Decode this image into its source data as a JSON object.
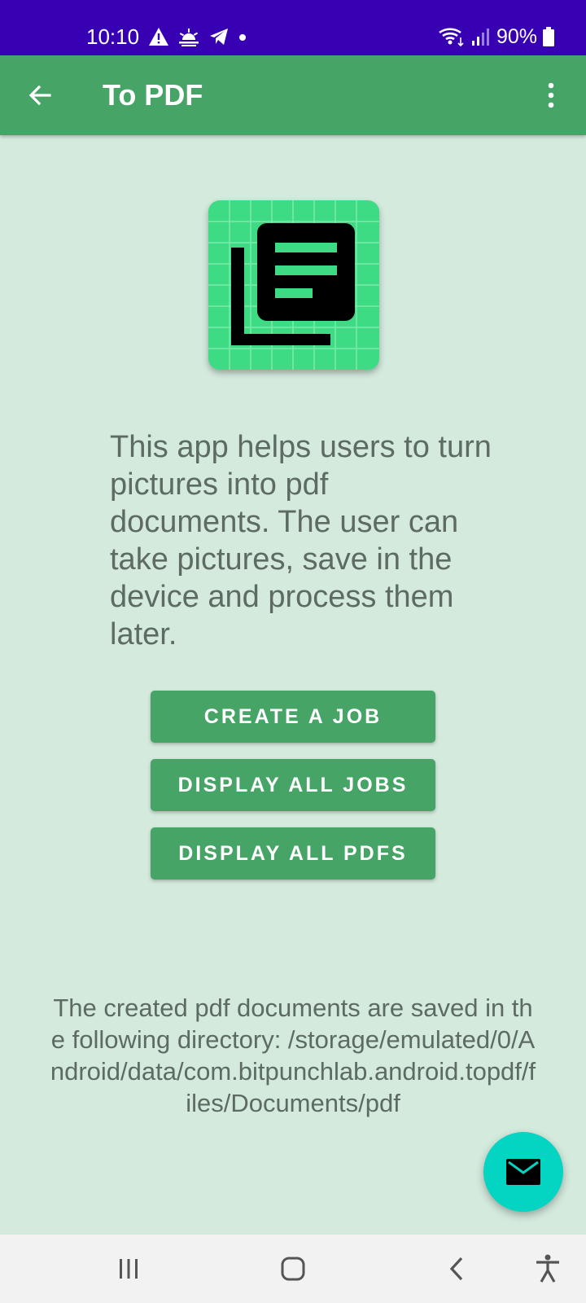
{
  "status_bar": {
    "time": "10:10",
    "battery": "90%",
    "left_icons": [
      "warning-icon",
      "weather-icon",
      "telegram-icon",
      "dot-icon"
    ],
    "right_icons": [
      "wifi-icon",
      "signal-icon",
      "battery-icon"
    ]
  },
  "app_bar": {
    "title": "To PDF",
    "back_icon": "arrow-back-icon",
    "menu_icon": "more-vert-icon",
    "color": "#46a466"
  },
  "main": {
    "description": "This app helps users to turn pictures into pdf documents. The user can take pictures, save in the device and process them later.",
    "buttons": [
      {
        "label": "CREATE A JOB"
      },
      {
        "label": "DISPLAY ALL JOBS"
      },
      {
        "label": "DISPLAY ALL PDFS"
      }
    ],
    "footer_note": "The created pdf documents are saved in the following directory: /storage/emulated/0/Android/data/com.bitpunchlab.android.topdf/files/Documents/pdf",
    "fab_icon": "mail-icon"
  },
  "nav_bar": {
    "items": [
      "recents-icon",
      "home-icon",
      "back-icon",
      "accessibility-icon"
    ]
  },
  "colors": {
    "status_bar": "#3700b3",
    "primary": "#46a466",
    "background": "#d4eadd",
    "fab": "#04d4c2",
    "logo_bg": "#3ddc84",
    "text": "#5d6b62"
  }
}
